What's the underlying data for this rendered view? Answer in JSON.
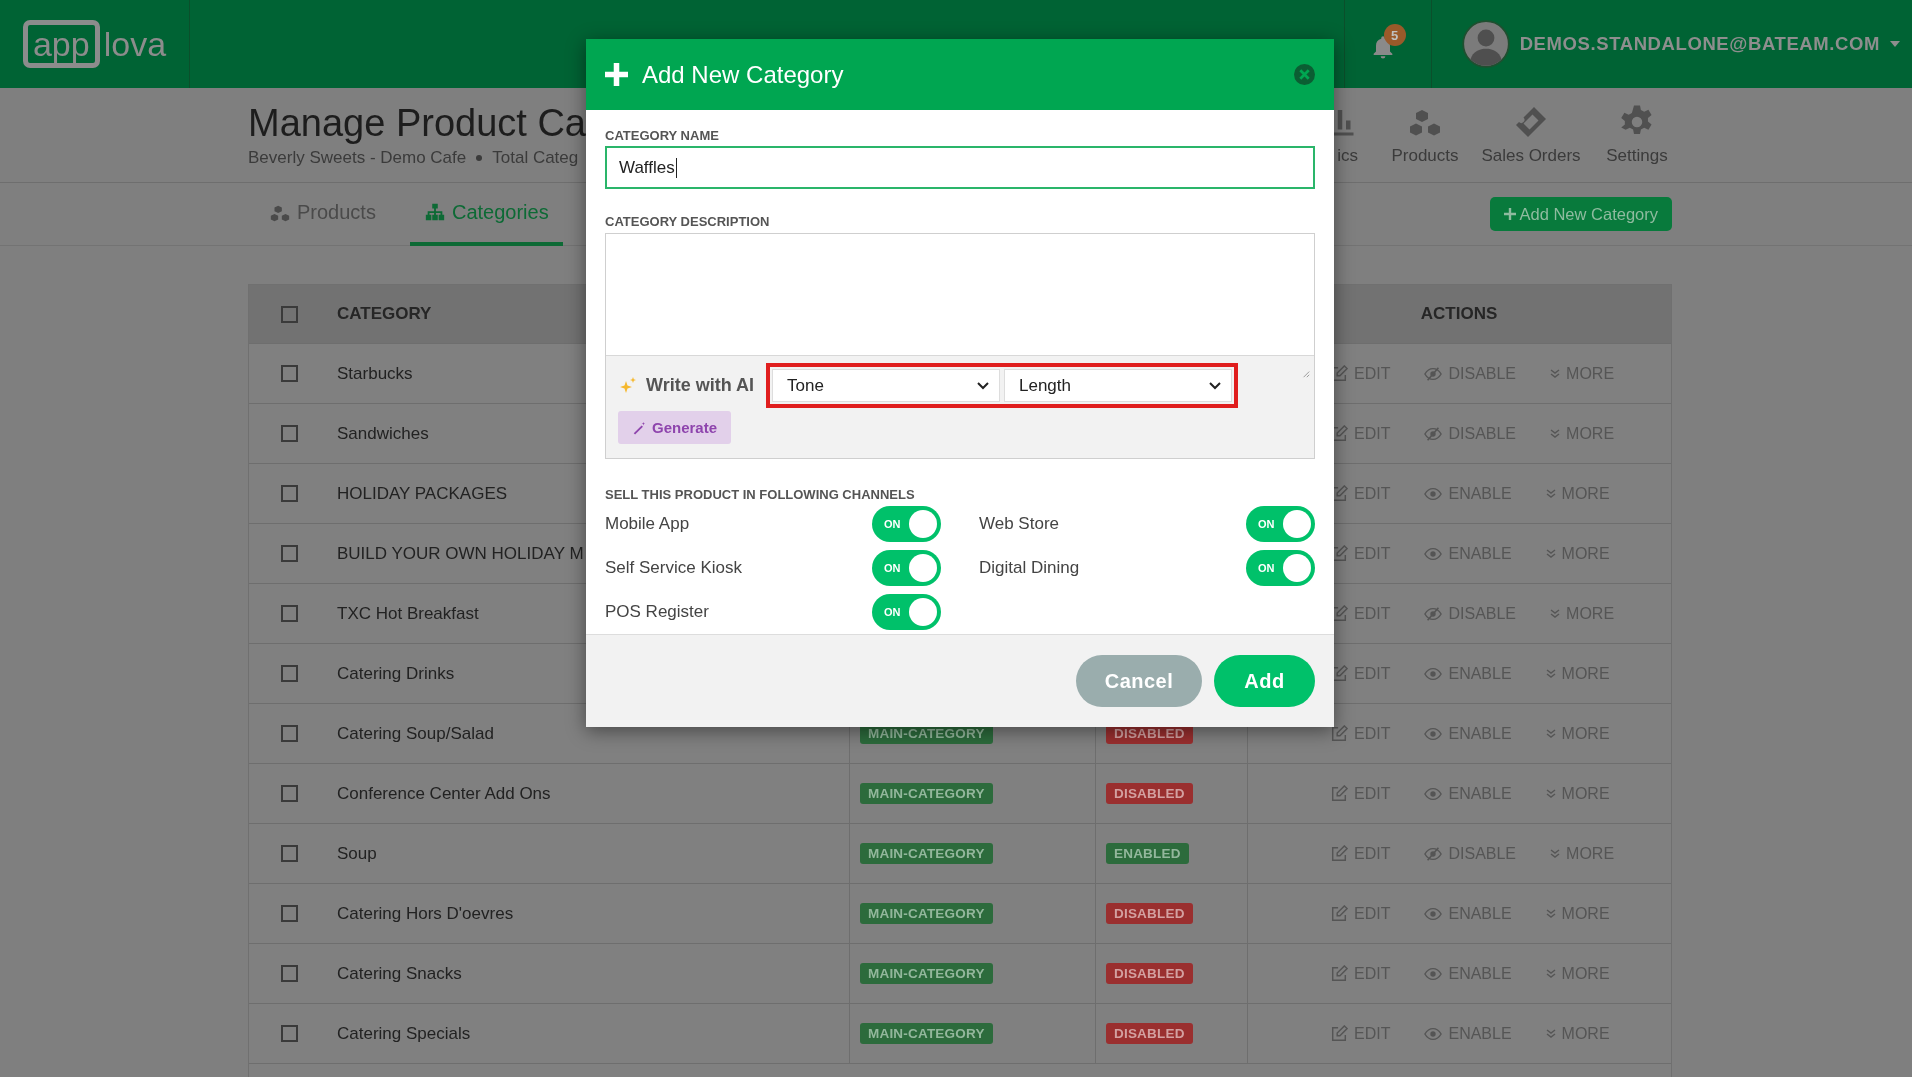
{
  "topbar": {
    "logo": {
      "boxed": "app",
      "plain": "lova"
    },
    "notifications": {
      "count": "5"
    },
    "user": {
      "email": "DEMOS.STANDALONE@BATEAM.COM"
    }
  },
  "header": {
    "title": "Manage Product Ca",
    "subtitle": [
      "Beverly Sweets - Demo Cafe",
      "Total Categ"
    ],
    "nav": [
      {
        "kind": "analytics",
        "label": "ics"
      },
      {
        "kind": "products",
        "label": "Products"
      },
      {
        "kind": "orders",
        "label": "Sales Orders"
      },
      {
        "kind": "settings",
        "label": "Settings"
      }
    ]
  },
  "tabs": [
    {
      "kind": "products",
      "label": "Products",
      "selected": false
    },
    {
      "kind": "categories",
      "label": "Categories",
      "selected": true
    }
  ],
  "add_button": {
    "label": "Add New Category"
  },
  "table": {
    "columns": [
      "CATEGORY",
      "ACTIONS"
    ],
    "select_all_checked": false,
    "rows": [
      {
        "checked": false,
        "name": "Starbucks",
        "edit": "EDIT",
        "toggle": {
          "kind": "disable",
          "label": "DISABLE"
        },
        "more": "MORE"
      },
      {
        "checked": false,
        "name": "Sandwiches",
        "edit": "EDIT",
        "toggle": {
          "kind": "disable",
          "label": "DISABLE"
        },
        "more": "MORE"
      },
      {
        "checked": false,
        "name": "HOLIDAY PACKAGES",
        "edit": "EDIT",
        "toggle": {
          "kind": "enable",
          "label": "ENABLE"
        },
        "more": "MORE"
      },
      {
        "checked": false,
        "name": "BUILD YOUR OWN HOLIDAY M",
        "edit": "EDIT",
        "toggle": {
          "kind": "enable",
          "label": "ENABLE"
        },
        "more": "MORE"
      },
      {
        "checked": false,
        "name": "TXC Hot Breakfast",
        "edit": "EDIT",
        "toggle": {
          "kind": "disable",
          "label": "DISABLE"
        },
        "more": "MORE"
      },
      {
        "checked": false,
        "name": "Catering Drinks",
        "edit": "EDIT",
        "toggle": {
          "kind": "enable",
          "label": "ENABLE"
        },
        "more": "MORE"
      },
      {
        "checked": false,
        "name": "Catering Soup/Salad",
        "type": "MAIN-CATEGORY",
        "status": {
          "label": "DISABLED",
          "enabled": false
        },
        "edit": "EDIT",
        "toggle": {
          "kind": "enable",
          "label": "ENABLE"
        },
        "more": "MORE"
      },
      {
        "checked": false,
        "name": "Conference Center Add Ons",
        "type": "MAIN-CATEGORY",
        "status": {
          "label": "DISABLED",
          "enabled": false
        },
        "edit": "EDIT",
        "toggle": {
          "kind": "enable",
          "label": "ENABLE"
        },
        "more": "MORE"
      },
      {
        "checked": false,
        "name": "Soup",
        "type": "MAIN-CATEGORY",
        "status": {
          "label": "ENABLED",
          "enabled": true
        },
        "edit": "EDIT",
        "toggle": {
          "kind": "disable",
          "label": "DISABLE"
        },
        "more": "MORE"
      },
      {
        "checked": false,
        "name": "Catering Hors D'oevres",
        "type": "MAIN-CATEGORY",
        "status": {
          "label": "DISABLED",
          "enabled": false
        },
        "edit": "EDIT",
        "toggle": {
          "kind": "enable",
          "label": "ENABLE"
        },
        "more": "MORE"
      },
      {
        "checked": false,
        "name": "Catering Snacks",
        "type": "MAIN-CATEGORY",
        "status": {
          "label": "DISABLED",
          "enabled": false
        },
        "edit": "EDIT",
        "toggle": {
          "kind": "enable",
          "label": "ENABLE"
        },
        "more": "MORE"
      },
      {
        "checked": false,
        "name": "Catering Specials",
        "type": "MAIN-CATEGORY",
        "status": {
          "label": "DISABLED",
          "enabled": false
        },
        "edit": "EDIT",
        "toggle": {
          "kind": "enable",
          "label": "ENABLE"
        },
        "more": "MORE"
      }
    ]
  },
  "modal": {
    "title": "Add New Category",
    "name_label": "CATEGORY NAME",
    "name_value": "Waffles",
    "description_label": "CATEGORY DESCRIPTION",
    "ai": {
      "label": "Write with AI",
      "selects": [
        "Tone",
        "Length"
      ],
      "generate": "Generate"
    },
    "channels_label": "SELL THIS PRODUCT IN FOLLOWING CHANNELS",
    "channels": [
      {
        "label": "Mobile App",
        "on": true,
        "state_text": "ON"
      },
      {
        "label": "Web Store",
        "on": true,
        "state_text": "ON"
      },
      {
        "label": "Self Service Kiosk",
        "on": true,
        "state_text": "ON"
      },
      {
        "label": "Digital Dining",
        "on": true,
        "state_text": "ON"
      },
      {
        "label": "POS Register",
        "on": true,
        "state_text": "ON"
      }
    ],
    "buttons": [
      {
        "kind": "cancel",
        "label": "Cancel"
      },
      {
        "kind": "primary",
        "label": "Add"
      }
    ]
  }
}
